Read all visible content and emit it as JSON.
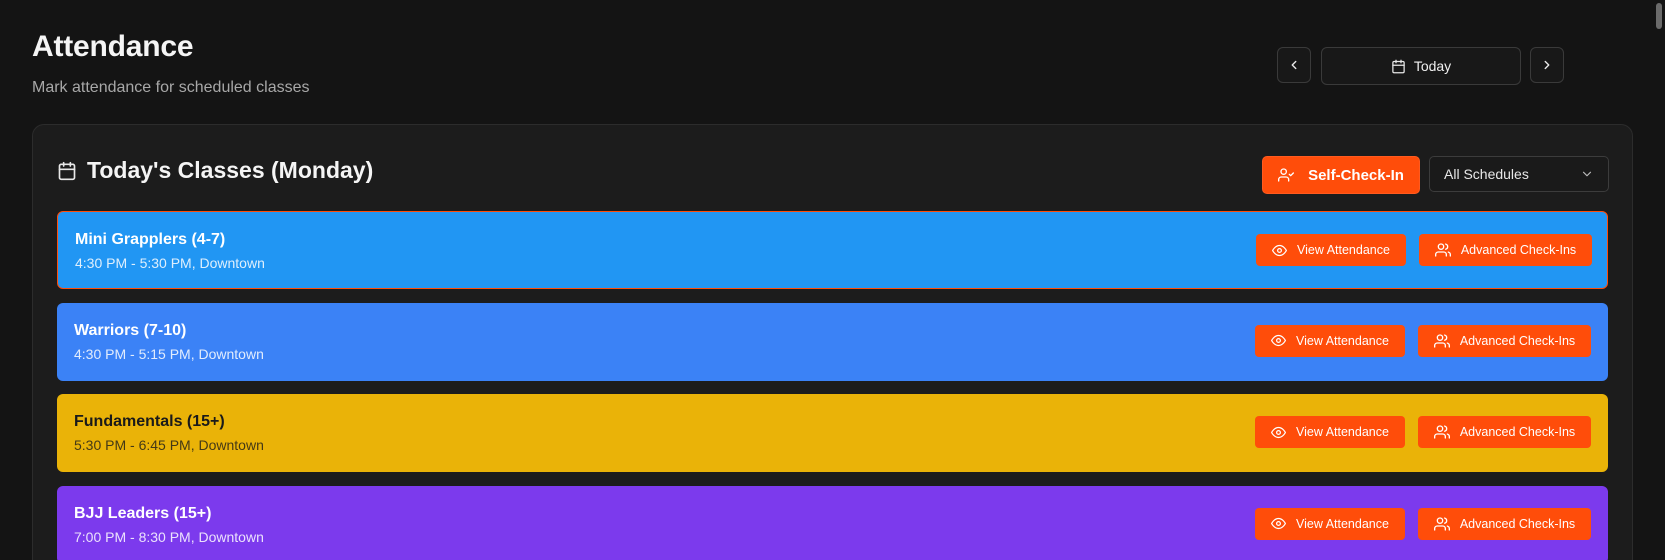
{
  "header": {
    "title": "Attendance",
    "subtitle": "Mark attendance for scheduled classes"
  },
  "date_nav": {
    "today_label": "Today",
    "prev_icon": "chevron-left-icon",
    "next_icon": "chevron-right-icon",
    "calendar_icon": "calendar-icon"
  },
  "card": {
    "title": "Today's Classes (Monday)",
    "self_checkin_label": "Self-Check-In",
    "schedule_filter": {
      "selected": "All Schedules"
    }
  },
  "classes": [
    {
      "name": "Mini Grapplers (4-7)",
      "time": "4:30 PM - 5:30 PM, Downtown",
      "color": "#2196f3",
      "text_color": "#ffffff",
      "selected": true
    },
    {
      "name": "Warriors (7-10)",
      "time": "4:30 PM - 5:15 PM, Downtown",
      "color": "#3b82f6",
      "text_color": "#ffffff",
      "selected": false
    },
    {
      "name": "Fundamentals (15+)",
      "time": "5:30 PM - 6:45 PM, Downtown",
      "color": "#eab308",
      "text_color": "#1a1a1a",
      "selected": false
    },
    {
      "name": "BJJ Leaders (15+)",
      "time": "7:00 PM - 8:30 PM, Downtown",
      "color": "#7c3aed",
      "text_color": "#ffffff",
      "selected": false
    }
  ],
  "row_buttons": {
    "view_label": "View Attendance",
    "advanced_label": "Advanced Check-Ins"
  },
  "colors": {
    "accent": "#ff4d0a",
    "background": "#141414",
    "card": "#1c1c1c"
  }
}
